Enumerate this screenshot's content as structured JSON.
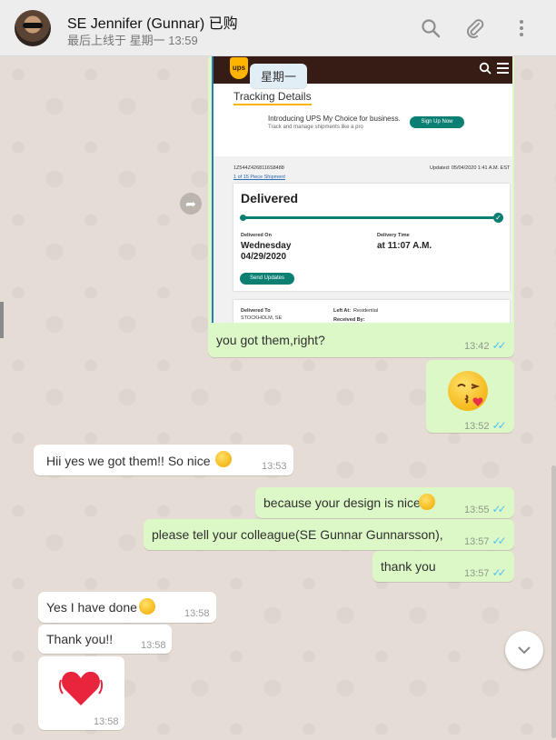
{
  "header": {
    "contact_name": "SE Jennifer (Gunnar) 已购",
    "last_seen": "最后上线于 星期一 13:59",
    "icons": [
      "search-icon",
      "paperclip-icon",
      "menu-icon"
    ]
  },
  "chat": {
    "date_chip": "星期一",
    "ups": {
      "title": "Tracking Details",
      "promo": "Introducing UPS My Choice for business.",
      "promo_sub": "Track and manage shipments like a pro",
      "signup": "Sign Up Now",
      "tracking_no": "1Z544Z4268116S8488",
      "pieces": "1 of 15 Piece Shipment",
      "updated": "Updated: 05/04/2020 1:41 A.M. EST",
      "status": "Delivered",
      "delivered_on_label": "Delivered On",
      "delivered_on_day": "Wednesday",
      "delivered_on_date": "04/29/2020",
      "delivery_time_label": "Delivery Time",
      "delivery_time": "at 11:07 A.M.",
      "send_updates": "Send Updates",
      "delivered_to_label": "Delivered To",
      "delivered_to": "STOCKHOLM, SE",
      "left_at_label": "Left At:",
      "left_at": "Residential",
      "received_by_label": "Received By:"
    },
    "messages": [
      {
        "text": "you got them,right?",
        "time": "13:42"
      },
      {
        "text": "",
        "time": "13:52"
      },
      {
        "text": "Hii yes we got them!! So nice",
        "time": "13:53"
      },
      {
        "text": "because your design is nice",
        "time": "13:55"
      },
      {
        "text": "please tell your colleague(SE Gunnar Gunnarsson),",
        "time": "13:57"
      },
      {
        "text": "thank you",
        "time": "13:57"
      },
      {
        "text": "Yes I have done",
        "time": "13:58"
      },
      {
        "text": "Thank you!!",
        "time": "13:58"
      },
      {
        "text": "",
        "time": "13:58"
      }
    ]
  },
  "colors": {
    "outgoing_bubble": "#dcf8c6",
    "incoming_bubble": "#ffffff",
    "read_ticks": "#4fc3f7",
    "ups_brown": "#351c15",
    "ups_teal": "#0a7f72"
  }
}
